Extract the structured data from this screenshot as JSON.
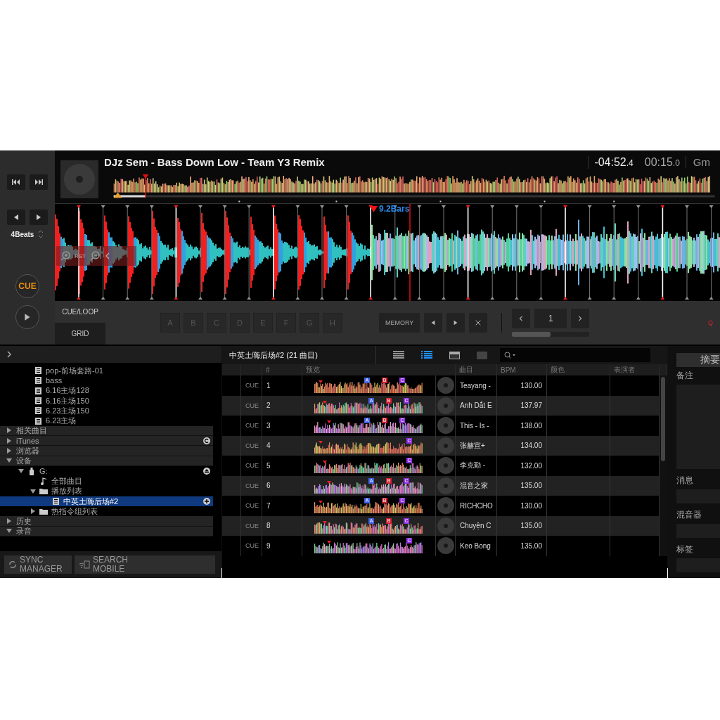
{
  "deck": {
    "title": "DJz Sem - Bass Down Low - Team Y3 Remix",
    "remaining_time": "-04:52",
    "remaining_fraction": ".4",
    "elapsed_time": "00:15",
    "elapsed_fraction": ".0",
    "key": "Gm",
    "beat_jump": "4Beats",
    "bars_label": "9.2Bars",
    "cue_button": "CUE",
    "zoom_reset": "RST",
    "tabs": [
      {
        "label": "CUE/LOOP",
        "selected": true
      },
      {
        "label": "GRID",
        "selected": false
      }
    ],
    "hot_cues": [
      "A",
      "B",
      "C",
      "D",
      "E",
      "F",
      "G",
      "H"
    ],
    "memory_button": "MEMORY",
    "loop_counter": "1",
    "loop_progress": {
      "level": 0.5
    },
    "quantize": "Q"
  },
  "sidebar": {
    "playlists": [
      "pop-前场套路-01",
      "bass",
      "6.16主场128",
      "6.16主场150",
      "6.23主场150",
      "6.23主场"
    ],
    "tree": [
      {
        "label": "相关曲目",
        "kind": "section",
        "expanded": false,
        "selected": false
      },
      {
        "label": "iTunes",
        "kind": "source",
        "expanded": false,
        "selected": false
      },
      {
        "label": "浏览器",
        "kind": "section",
        "expanded": false,
        "selected": false
      },
      {
        "label": "设备",
        "kind": "section",
        "expanded": true,
        "selected": false,
        "children": [
          {
            "label": "G:",
            "kind": "device",
            "expanded": true,
            "selected": false,
            "children": [
              {
                "label": "全部曲目",
                "kind": "tracks",
                "selected": false
              },
              {
                "label": "播放列表",
                "kind": "folder",
                "expanded": true,
                "selected": false,
                "children": [
                  {
                    "label": "中英土嗨后场#2",
                    "kind": "playlist",
                    "selected": true
                  }
                ]
              },
              {
                "label": "热指令组列表",
                "kind": "folder",
                "expanded": false,
                "selected": false
              }
            ]
          }
        ]
      },
      {
        "label": "历史",
        "kind": "section",
        "expanded": false,
        "selected": false
      },
      {
        "label": "录音",
        "kind": "section",
        "expanded": true,
        "selected": false
      }
    ],
    "buttons": [
      "SYNC MANAGER",
      "SEARCH MOBILE"
    ]
  },
  "table": {
    "title": "中英土嗨后场#2 (21 曲目)",
    "columns": [
      "#",
      "预览",
      "曲目",
      "BPM",
      "颜色",
      "表演者"
    ],
    "rows": [
      {
        "cue": "CUE",
        "number": "1",
        "title": "Teayang -",
        "bpm": "130.00",
        "cue_marks": [
          "A",
          "B",
          "C"
        ]
      },
      {
        "cue": "CUE",
        "number": "2",
        "title": "Anh Dắt E",
        "bpm": "137.97",
        "cue_marks": [
          "A",
          "B",
          "C"
        ]
      },
      {
        "cue": "CUE",
        "number": "3",
        "title": "This - Is -",
        "bpm": "138.00",
        "cue_marks": [
          "A",
          "B",
          "C"
        ]
      },
      {
        "cue": "CUE",
        "number": "4",
        "title": "张赫宣+",
        "bpm": "134.00",
        "cue_marks": [
          "C"
        ]
      },
      {
        "cue": "CUE",
        "number": "5",
        "title": "李克勤 -",
        "bpm": "132.00",
        "cue_marks": [
          "C"
        ]
      },
      {
        "cue": "CUE",
        "number": "6",
        "title": "混音之家",
        "bpm": "135.00",
        "cue_marks": [
          "A",
          "B",
          "C"
        ]
      },
      {
        "cue": "CUE",
        "number": "7",
        "title": "RICHCHO",
        "bpm": "130.00",
        "cue_marks": [
          "A",
          "B",
          "C"
        ]
      },
      {
        "cue": "CUE",
        "number": "8",
        "title": "Chuyện C",
        "bpm": "135.00",
        "cue_marks": [
          "A",
          "B",
          "C"
        ]
      },
      {
        "cue": "CUE",
        "number": "9",
        "title": "Keo Bong",
        "bpm": "135.00",
        "cue_marks": [
          "C"
        ]
      }
    ]
  },
  "info_panel": {
    "tab": "摘要",
    "fields": [
      "备注",
      "消息",
      "混音器",
      "标签"
    ]
  }
}
